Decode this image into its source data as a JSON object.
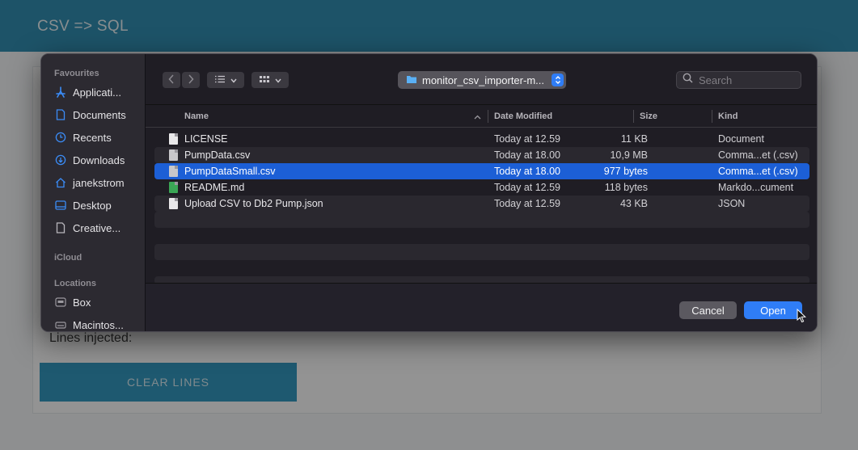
{
  "app": {
    "title": "CSV => SQL",
    "lines_injected_label": "Lines injected:",
    "clear_lines_label": "CLEAR LINES"
  },
  "dialog": {
    "sidebar": {
      "sections": [
        {
          "label": "Favourites",
          "items": [
            {
              "label": "Applicati...",
              "icon": "applications-icon"
            },
            {
              "label": "Documents",
              "icon": "document-icon"
            },
            {
              "label": "Recents",
              "icon": "clock-icon"
            },
            {
              "label": "Downloads",
              "icon": "download-icon"
            },
            {
              "label": "janekstrom",
              "icon": "home-icon"
            },
            {
              "label": "Desktop",
              "icon": "desktop-icon"
            },
            {
              "label": "Creative...",
              "icon": "file-icon"
            }
          ]
        },
        {
          "label": "iCloud",
          "items": []
        },
        {
          "label": "Locations",
          "items": [
            {
              "label": "Box",
              "icon": "drive-icon"
            },
            {
              "label": "Macintos...",
              "icon": "disk-icon"
            }
          ]
        }
      ]
    },
    "toolbar": {
      "path": "monitor_csv_importer-m...",
      "search_placeholder": "Search"
    },
    "columns": {
      "name": "Name",
      "date": "Date Modified",
      "size": "Size",
      "kind": "Kind"
    },
    "files": [
      {
        "name": "LICENSE",
        "date": "Today at 12.59",
        "size": "11 KB",
        "kind": "Document",
        "icon": "generic"
      },
      {
        "name": "PumpData.csv",
        "date": "Today at 18.00",
        "size": "10,9 MB",
        "kind": "Comma...et (.csv)",
        "icon": "csv"
      },
      {
        "name": "PumpDataSmall.csv",
        "date": "Today at 18.00",
        "size": "977 bytes",
        "kind": "Comma...et (.csv)",
        "icon": "csv",
        "selected": true
      },
      {
        "name": "README.md",
        "date": "Today at 12.59",
        "size": "118 bytes",
        "kind": "Markdo...cument",
        "icon": "md"
      },
      {
        "name": "Upload CSV to Db2 Pump.json",
        "date": "Today at 12.59",
        "size": "43 KB",
        "kind": "JSON",
        "icon": "generic"
      }
    ],
    "buttons": {
      "cancel": "Cancel",
      "open": "Open"
    }
  },
  "colors": {
    "accent": "#2f7df6",
    "selection": "#1c5fd6",
    "app_header": "#127fa8"
  }
}
